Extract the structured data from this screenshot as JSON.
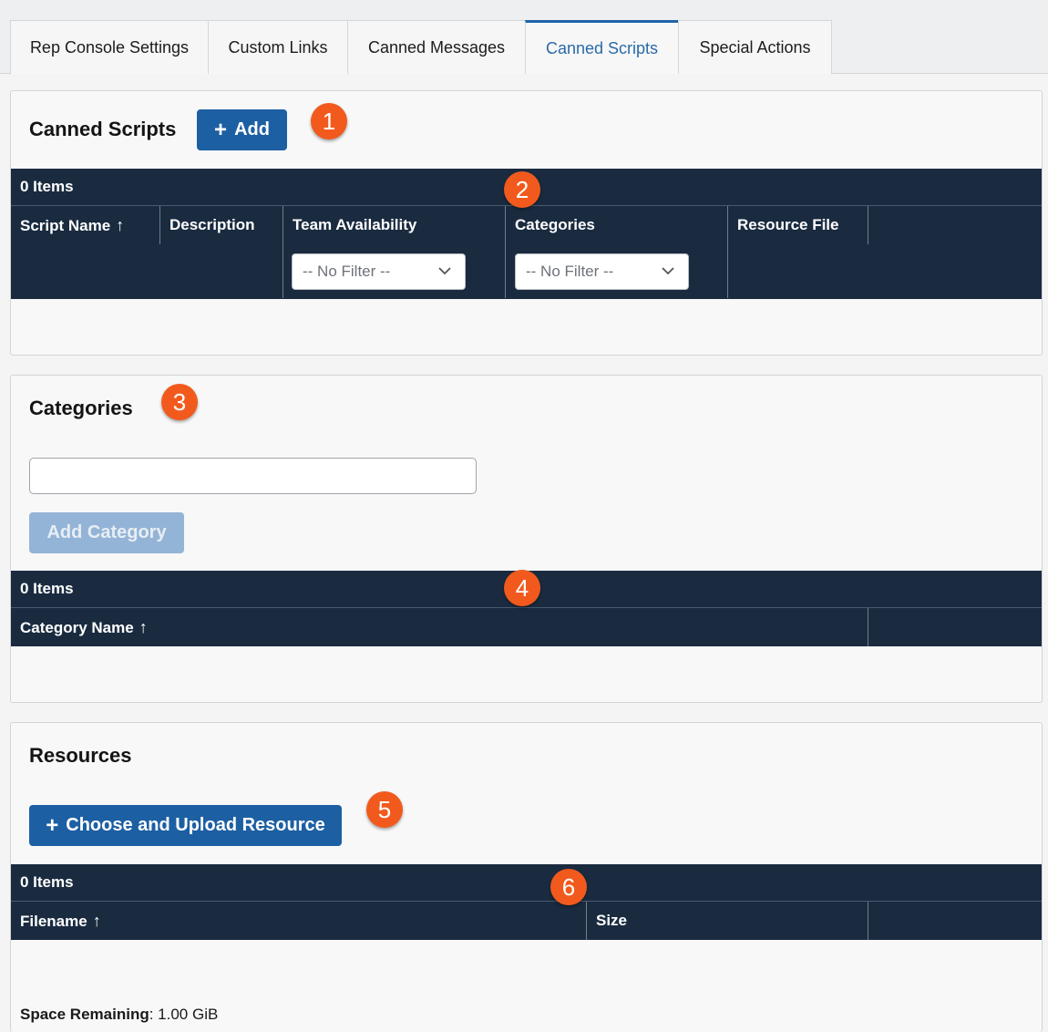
{
  "tabs": [
    {
      "label": "Rep Console Settings"
    },
    {
      "label": "Custom Links"
    },
    {
      "label": "Canned Messages"
    },
    {
      "label": "Canned Scripts"
    },
    {
      "label": "Special Actions"
    }
  ],
  "scripts": {
    "title": "Canned Scripts",
    "add_label": "Add",
    "count": "0 Items",
    "columns": [
      "Script Name",
      "Description",
      "Team Availability",
      "Categories",
      "Resource File"
    ],
    "team_filter": "-- No Filter --",
    "category_filter": "-- No Filter --"
  },
  "categories": {
    "title": "Categories",
    "input_value": "",
    "add_label": "Add Category",
    "count": "0 Items",
    "columns": [
      "Category Name"
    ]
  },
  "resources": {
    "title": "Resources",
    "upload_label": "Choose and Upload Resource",
    "count": "0 Items",
    "columns": [
      "Filename",
      "Size"
    ],
    "space_label": "Space Remaining",
    "space_value": "1.00 GiB"
  },
  "badges": [
    "1",
    "2",
    "3",
    "4",
    "5",
    "6"
  ],
  "colors": {
    "accent": "#1d5fa3",
    "badge": "#f25a1d",
    "grid": "#1a2b40"
  }
}
